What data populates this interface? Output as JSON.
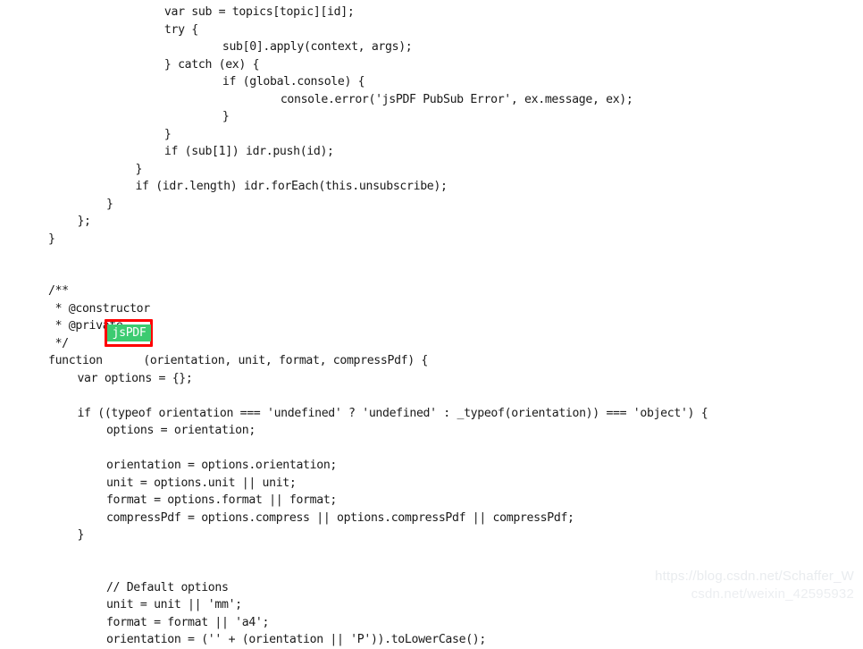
{
  "page": {
    "background_color": "#ffffff",
    "text_color": "#1a1a1a",
    "kind": "source-code-screenshot",
    "language": "javascript"
  },
  "code": {
    "lines": [
      {
        "indent": 4,
        "text": "var sub = topics[topic][id];"
      },
      {
        "indent": 4,
        "text": "try {"
      },
      {
        "indent": 6,
        "text": "sub[0].apply(context, args);"
      },
      {
        "indent": 4,
        "text": "} catch (ex) {"
      },
      {
        "indent": 6,
        "text": "if (global.console) {"
      },
      {
        "indent": 8,
        "text": "console.error('jsPDF PubSub Error', ex.message, ex);"
      },
      {
        "indent": 6,
        "text": "}"
      },
      {
        "indent": 4,
        "text": "}"
      },
      {
        "indent": 4,
        "text": "if (sub[1]) idr.push(id);"
      },
      {
        "indent": 3,
        "text": "}"
      },
      {
        "indent": 3,
        "text": "if (idr.length) idr.forEach(this.unsubscribe);"
      },
      {
        "indent": 2,
        "text": "}"
      },
      {
        "indent": 1,
        "text": "};"
      },
      {
        "indent": 0,
        "text": "}"
      },
      {
        "indent": 0,
        "text": ""
      },
      {
        "indent": 0,
        "text": ""
      },
      {
        "indent": 0,
        "text": "/**"
      },
      {
        "indent": 0,
        "text": " * @constructor"
      },
      {
        "indent": 0,
        "text": " * @private"
      },
      {
        "indent": 0,
        "text": " */"
      },
      {
        "indent": 0,
        "text": "function jsPDF(orientation, unit, format, compressPdf) {"
      },
      {
        "indent": 1,
        "text": "var options = {};"
      },
      {
        "indent": 0,
        "text": ""
      },
      {
        "indent": 1,
        "text": "if ((typeof orientation === 'undefined' ? 'undefined' : _typeof(orientation)) === 'object') {"
      },
      {
        "indent": 2,
        "text": "options = orientation;"
      },
      {
        "indent": 0,
        "text": ""
      },
      {
        "indent": 2,
        "text": "orientation = options.orientation;"
      },
      {
        "indent": 2,
        "text": "unit = options.unit || unit;"
      },
      {
        "indent": 2,
        "text": "format = options.format || format;"
      },
      {
        "indent": 2,
        "text": "compressPdf = options.compress || options.compressPdf || compressPdf;"
      },
      {
        "indent": 1,
        "text": "}"
      },
      {
        "indent": 0,
        "text": ""
      },
      {
        "indent": 0,
        "text": ""
      },
      {
        "indent": 2,
        "text": "// Default options"
      },
      {
        "indent": 2,
        "text": "unit = unit || 'mm';"
      },
      {
        "indent": 2,
        "text": "format = format || 'a4';"
      },
      {
        "indent": 2,
        "text": "orientation = ('' + (orientation || 'P')).toLowerCase();"
      }
    ]
  },
  "highlight": {
    "token": "jsPDF",
    "token_background_color": "#3ccb71",
    "token_text_color": "#ffffff",
    "box_border_color": "#ff0000"
  },
  "watermark": {
    "line1": "https://blog.csdn.net/Schaffer_W",
    "line2": "csdn.net/weixin_42595932",
    "color": "#e9ecef"
  }
}
